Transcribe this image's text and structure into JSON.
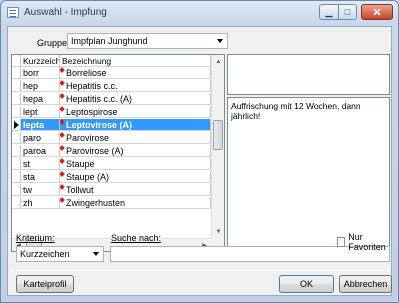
{
  "window": {
    "title": "Auswahl - Impfung"
  },
  "group": {
    "label": "Gruppe:",
    "value": "Impfplan Junghund"
  },
  "grid": {
    "headers": {
      "code": "Kurzzeichen",
      "name": "Bezeichnung"
    },
    "rows": [
      {
        "code": "borr",
        "name": "Borreliose"
      },
      {
        "code": "hep",
        "name": "Hepatitis c.c."
      },
      {
        "code": "hepa",
        "name": "Hepatitis c.c. (A)"
      },
      {
        "code": "lept",
        "name": "Leptospirose"
      },
      {
        "code": "lepta",
        "name": "Leptovirose (A)"
      },
      {
        "code": "paro",
        "name": "Parovirose"
      },
      {
        "code": "paroa",
        "name": "Parovirose (A)"
      },
      {
        "code": "st",
        "name": "Staupe"
      },
      {
        "code": "sta",
        "name": "Staupe (A)"
      },
      {
        "code": "tw",
        "name": "Tollwut"
      },
      {
        "code": "zh",
        "name": "Zwingerhusten"
      }
    ],
    "selected_index": 4
  },
  "note": {
    "text": "Auffrischung mit 12 Wochen, dann jährlich!"
  },
  "criterion": {
    "label": "Kriterium:",
    "value": "Kurzzeichen"
  },
  "search": {
    "label": "Suche nach:",
    "value": ""
  },
  "favorites": {
    "label": "Nur Favoriten",
    "checked": false
  },
  "buttons": {
    "kartei": "Karteiprofil",
    "ok": "OK",
    "cancel": "Abbrechen"
  },
  "colors": {
    "selection": "#3399ff",
    "marker": "#d62020",
    "title_bg": "#c8d8ec"
  }
}
